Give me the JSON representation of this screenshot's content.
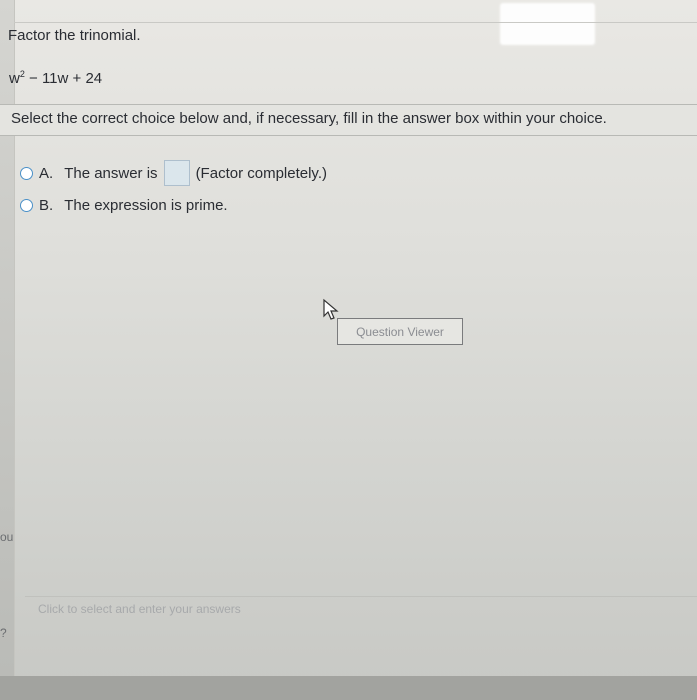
{
  "question": {
    "title": "Factor the trinomial.",
    "expression_base": "w",
    "expression_exponent": "2",
    "expression_rest": " − 11w + 24",
    "instruction": "Select the correct choice below and, if necessary, fill in the answer box within your choice."
  },
  "choices": [
    {
      "letter": "A.",
      "text_before": "The answer is",
      "text_after": "(Factor completely.)",
      "selected": false
    },
    {
      "letter": "B.",
      "text": "The expression is prime.",
      "selected": false
    }
  ],
  "question_viewer_label": "Question Viewer",
  "hint_text": "Click to select and enter your answers",
  "edge_fragments": [
    "ou",
    "?"
  ],
  "colors": {
    "radio_border": "#4a90c8",
    "answer_box_fill": "#dbe6ec",
    "background": "#e0e0dc"
  },
  "icons": [
    "radio-icon",
    "mouse-cursor-icon"
  ]
}
